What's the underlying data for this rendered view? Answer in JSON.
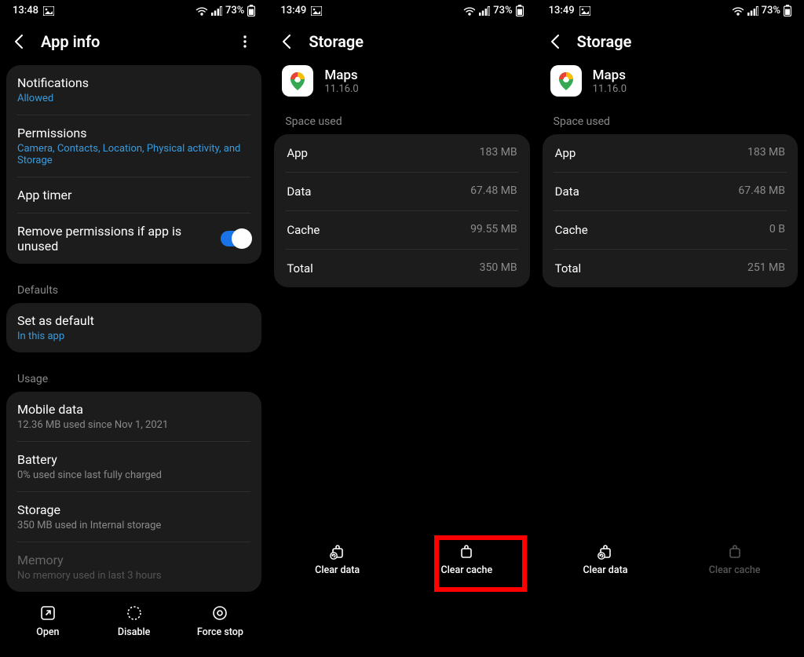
{
  "panel1": {
    "status": {
      "time": "13:48",
      "battery": "73%"
    },
    "title": "App info",
    "rows": {
      "notifications": {
        "title": "Notifications",
        "sub": "Allowed"
      },
      "permissions": {
        "title": "Permissions",
        "sub": "Camera, Contacts, Location, Physical activity, and Storage"
      },
      "apptimer": {
        "title": "App timer"
      },
      "removeperm": {
        "title": "Remove permissions if app is unused"
      }
    },
    "defaults_label": "Defaults",
    "setdefault": {
      "title": "Set as default",
      "sub": "In this app"
    },
    "usage_label": "Usage",
    "usage": {
      "mobile": {
        "title": "Mobile data",
        "sub": "12.36 MB used since Nov 1, 2021"
      },
      "battery": {
        "title": "Battery",
        "sub": "0% used since last fully charged"
      },
      "storage": {
        "title": "Storage",
        "sub": "350 MB used in Internal storage"
      },
      "memory": {
        "title": "Memory",
        "sub": "No memory used in last 3 hours"
      }
    },
    "bottom": {
      "open": "Open",
      "disable": "Disable",
      "force": "Force stop"
    }
  },
  "panel2": {
    "status": {
      "time": "13:49",
      "battery": "73%"
    },
    "title": "Storage",
    "app": {
      "name": "Maps",
      "version": "11.16.0"
    },
    "space_label": "Space used",
    "rows": {
      "app": {
        "label": "App",
        "value": "183 MB"
      },
      "data": {
        "label": "Data",
        "value": "67.48 MB"
      },
      "cache": {
        "label": "Cache",
        "value": "99.55 MB"
      },
      "total": {
        "label": "Total",
        "value": "350 MB"
      }
    },
    "bottom": {
      "cleardata": "Clear data",
      "clearcache": "Clear cache"
    }
  },
  "panel3": {
    "status": {
      "time": "13:49",
      "battery": "73%"
    },
    "title": "Storage",
    "app": {
      "name": "Maps",
      "version": "11.16.0"
    },
    "space_label": "Space used",
    "rows": {
      "app": {
        "label": "App",
        "value": "183 MB"
      },
      "data": {
        "label": "Data",
        "value": "67.48 MB"
      },
      "cache": {
        "label": "Cache",
        "value": "0 B"
      },
      "total": {
        "label": "Total",
        "value": "251 MB"
      }
    },
    "bottom": {
      "cleardata": "Clear data",
      "clearcache": "Clear cache"
    }
  }
}
